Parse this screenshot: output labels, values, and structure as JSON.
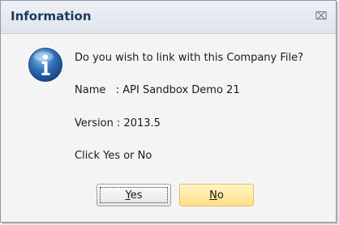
{
  "window": {
    "title": "Information",
    "close_glyph": "⌧"
  },
  "icon": "info-icon",
  "message": {
    "question": "Do you wish to link with this Company File?",
    "name_line": "Name   : API Sandbox Demo 21",
    "version_line": "Version : 2013.5",
    "instruction": "Click Yes or No"
  },
  "buttons": {
    "yes_mnemonic": "Y",
    "yes_rest": "es",
    "no_mnemonic": "N",
    "no_rest": "o"
  },
  "colors": {
    "title_text": "#1e395b",
    "icon_blue": "#2f6db5",
    "no_button_fill": "#ffe08a"
  }
}
